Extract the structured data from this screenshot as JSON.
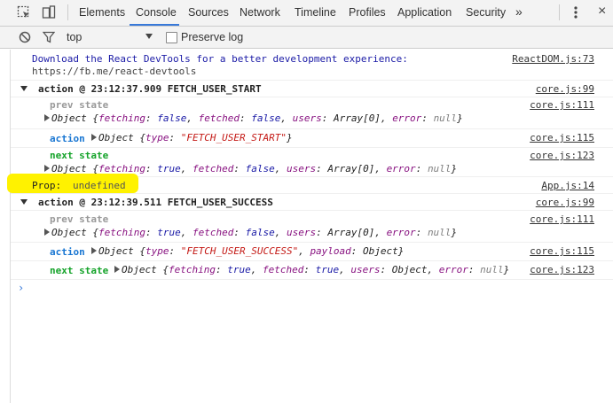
{
  "toolbar": {
    "tabs": [
      "Elements",
      "Console",
      "Sources",
      "Network",
      "Timeline",
      "Profiles",
      "Application",
      "Security"
    ],
    "active_tab": "Console",
    "more_tabs": "»",
    "close": "×"
  },
  "filterbar": {
    "context": "top",
    "preserve_log": "Preserve log",
    "preserve_checked": false
  },
  "console": {
    "devtools_msg_1": "Download the React DevTools for a better development experience:",
    "devtools_msg_2": "https://fb.me/react-devtools",
    "devtools_src": "ReactDOM.js:73",
    "group1": {
      "header": "action @ 23:12:37.909 FETCH_USER_START",
      "header_src": "core.js:99",
      "prev_label": "prev state",
      "prev_src": "core.js:111",
      "prev_obj": {
        "fetching": "false",
        "fetched": "false",
        "users": "Array[0]",
        "error": "null"
      },
      "action_label": "action",
      "action_src": "core.js:115",
      "action_type": "\"FETCH_USER_START\"",
      "next_label": "next state",
      "next_src": "core.js:123",
      "next_obj": {
        "fetching": "true",
        "fetched": "false",
        "users": "Array[0]",
        "error": "null"
      }
    },
    "prop_log": {
      "label": "Prop:",
      "value": "undefined",
      "src": "App.js:14"
    },
    "group2": {
      "header": "action @ 23:12:39.511 FETCH_USER_SUCCESS",
      "header_src": "core.js:99",
      "prev_label": "prev state",
      "prev_src": "core.js:111",
      "prev_obj": {
        "fetching": "true",
        "fetched": "false",
        "users": "Array[0]",
        "error": "null"
      },
      "action_label": "action",
      "action_src": "core.js:115",
      "action_type": "\"FETCH_USER_SUCCESS\"",
      "action_payload": "Object",
      "next_label": "next state",
      "next_src": "core.js:123",
      "next_obj": {
        "fetching": "true",
        "fetched": "true",
        "users": "Object",
        "error": "null"
      }
    },
    "prompt": "›"
  },
  "colors": {
    "highlight": "#fff200",
    "active_tab_underline": "#3879d9",
    "next_state_label": "#15a32a",
    "action_label": "#1976d2",
    "prev_state_label": "#999999"
  }
}
